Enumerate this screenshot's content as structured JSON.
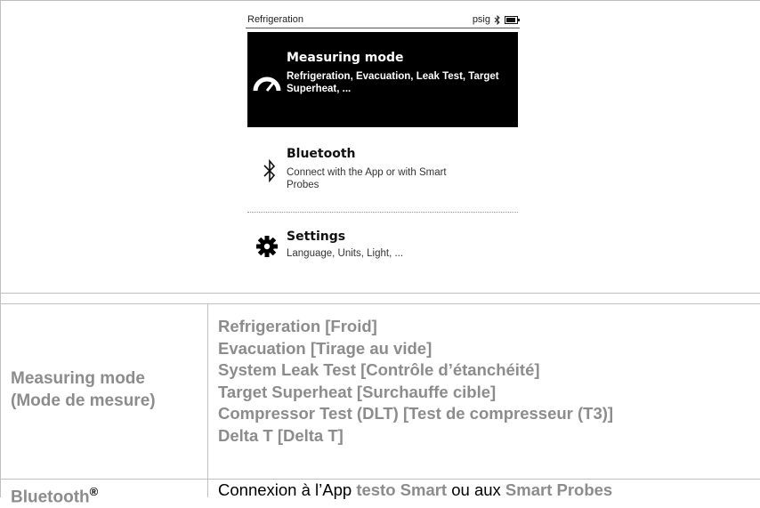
{
  "device_screen": {
    "status_bar": {
      "title": "Refrigeration",
      "unit": "psig"
    },
    "menu": [
      {
        "title": "Measuring mode",
        "description": "Refrigeration, Evacuation, Leak Test, Target Superheat, ...",
        "icon": "gauge-icon",
        "selected": true
      },
      {
        "title": "Bluetooth",
        "description": "Connect with the App or with Smart Probes",
        "icon": "bluetooth-icon",
        "selected": false
      },
      {
        "title": "Settings",
        "description": "Language, Units, Light, ...",
        "icon": "gear-icon",
        "selected": false
      }
    ]
  },
  "table": {
    "measuring_mode": {
      "label_line1": "Measuring mode",
      "label_line2": "(Mode de mesure)",
      "options": [
        "Refrigeration [Froid]",
        "Evacuation [Tirage au vide]",
        "System Leak Test [Contrôle d’étanchéité]",
        "Target Superheat [Surchauffe cible]",
        "Compressor Test (DLT) [Test de compresseur (T3)]",
        "Delta T [Delta T]"
      ]
    },
    "bluetooth": {
      "label": "Bluetooth",
      "label_sup": "®",
      "desc_part1": "Connexion à l’App ",
      "desc_highlight1": "testo Smart",
      "desc_part2": " ou aux ",
      "desc_highlight2": "Smart Probes"
    }
  },
  "colors": {
    "label_gray": "#8c8c8c",
    "selected_bg": "#000000"
  }
}
